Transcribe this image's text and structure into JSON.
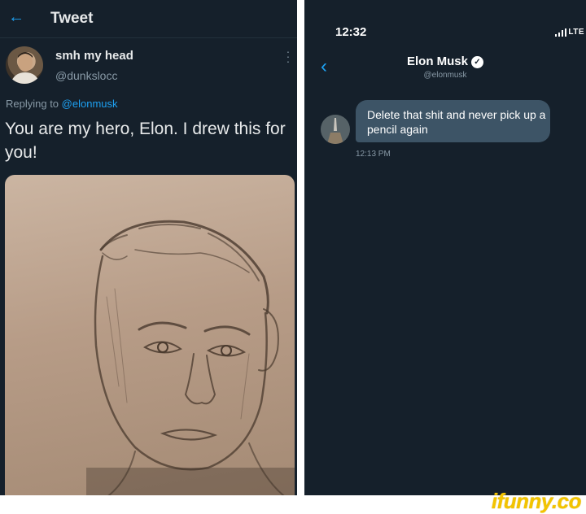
{
  "left_panel": {
    "header": {
      "back_icon": "arrow-left-icon",
      "title": "Tweet"
    },
    "author": {
      "display_name": "smh my head",
      "handle": "@dunkslocc"
    },
    "replying_prefix": "Replying to",
    "replying_to": "@elonmusk",
    "tweet_text": "You are my hero, Elon. I drew this for you!",
    "media": "pencil-sketch-portrait"
  },
  "right_panel": {
    "status_bar": {
      "time": "12:32",
      "network": "LTE"
    },
    "header": {
      "name": "Elon Musk",
      "handle": "@elonmusk",
      "back_icon": "chevron-left-icon",
      "verified_icon": "verified-badge-icon"
    },
    "messages": [
      {
        "text": "Delete that shit and never pick up a pencil again",
        "time": "12:13 PM"
      }
    ]
  },
  "watermark": "ifunny.co",
  "colors": {
    "background": "#15202b",
    "accent": "#1da1f2",
    "bubble": "#3d5466",
    "muted": "#8899a6",
    "watermark": "#f3c400"
  }
}
